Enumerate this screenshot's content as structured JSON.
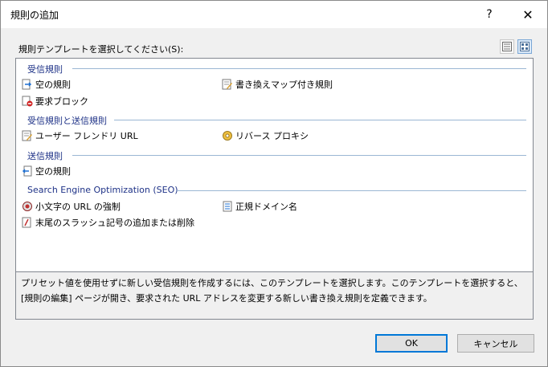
{
  "dialog": {
    "title": "規則の追加",
    "help": "?",
    "close": "✕"
  },
  "prompt": "規則テンプレートを選択してください(S):",
  "groups": {
    "inbound": "受信規則",
    "inout": "受信規則と送信規則",
    "outbound": "送信規則",
    "seo": "Search Engine Optimization (SEO)"
  },
  "items": {
    "blank_rule": "空の規則",
    "rewrite_map": "書き換えマップ付き規則",
    "block": "要求ブロック",
    "friendly_url": "ユーザー フレンドリ URL",
    "reverse_proxy": "リバース プロキシ",
    "out_blank": "空の規則",
    "lowercase": "小文字の URL の強制",
    "canonical": "正規ドメイン名",
    "trailing_slash": "末尾のスラッシュ記号の追加または削除"
  },
  "description": "プリセット値を使用せずに新しい受信規則を作成するには、このテンプレートを選択します。このテンプレートを選択すると、[規則の編集] ページが開き、要求された URL アドレスを変更する新しい書き換え規則を定義できます。",
  "buttons": {
    "ok": "OK",
    "cancel": "キャンセル"
  },
  "colors": {
    "group_text": "#1e3287",
    "accent": "#0078d7"
  }
}
